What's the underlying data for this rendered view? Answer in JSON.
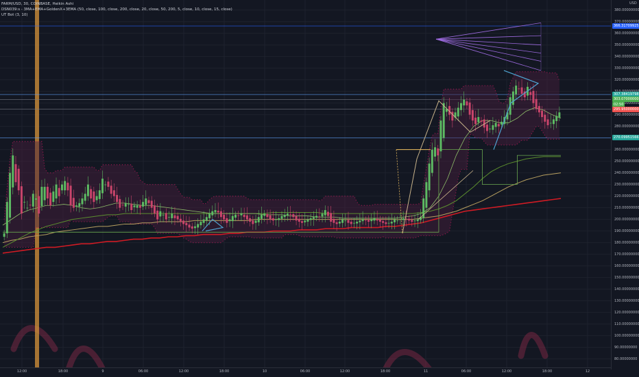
{
  "legend": {
    "line1": "FARM/USD, 30, COINBASE, Heikin Ashi",
    "line2": "DSN039:s - 3MA+EMA+GoldenX+3EMA (50, close, 100, close, 200, close, 20, close, 50, 200, 5, close, 10, close, 15, close)",
    "line3": "UT Bot (3, 10)"
  },
  "axis": {
    "currency": "USD",
    "price_ticks": [
      "380.00000000",
      "370.00000000",
      "360.00000000",
      "350.00000000",
      "340.00000000",
      "330.00000000",
      "320.00000000",
      "310.00000000",
      "300.00000000",
      "290.00000000",
      "280.00000000",
      "270.00000000",
      "260.00000000",
      "250.00000000",
      "240.00000000",
      "230.00000000",
      "220.00000000",
      "210.00000000",
      "200.00000000",
      "190.00000000",
      "180.00000000",
      "170.00000000",
      "160.00000000",
      "150.00000000",
      "140.00000000",
      "130.00000000",
      "120.00000000",
      "110.00000000",
      "100.00000000",
      "90.00000000",
      "80.00000000"
    ],
    "time_ticks": [
      "12:00",
      "18:00",
      "9",
      "06:00",
      "12:00",
      "18:00",
      "10",
      "06:00",
      "12:00",
      "18:00",
      "11",
      "06:00",
      "12:00",
      "18:00",
      "12"
    ]
  },
  "badges": [
    {
      "text": "366.31709925",
      "color": "#2962ff",
      "price": 366.3
    },
    {
      "text": "307.38419798",
      "color": "#26a69a",
      "price": 307.4
    },
    {
      "text": "303.07000000",
      "color": "#4caf50",
      "price": 303.1
    },
    {
      "text": "02:50",
      "color": "#4caf50",
      "price": 298.9
    },
    {
      "text": "295.95000000",
      "color": "#ef5350",
      "price": 294.8
    },
    {
      "text": "270.09951566",
      "color": "#26a69a",
      "price": 270.1
    }
  ],
  "chart_data": {
    "type": "candlestick",
    "symbol": "FARM/USD",
    "interval": "30",
    "exchange": "COINBASE",
    "style": "Heikin Ashi",
    "ylim": [
      75,
      385
    ],
    "x_labels": [
      "12:00",
      "18:00",
      "9",
      "06:00",
      "12:00",
      "18:00",
      "10",
      "06:00",
      "12:00",
      "18:00",
      "11",
      "06:00",
      "12:00",
      "18:00",
      "12"
    ],
    "close_series": [
      188,
      215,
      240,
      255,
      232,
      225,
      205,
      215,
      210,
      212,
      222,
      218,
      205,
      228,
      228,
      218,
      212,
      224,
      230,
      220,
      230,
      233,
      225,
      212,
      210,
      212,
      214,
      218,
      222,
      230,
      218,
      215,
      220,
      225,
      235,
      230,
      228,
      222,
      220,
      215,
      210,
      212,
      214,
      213,
      208,
      212,
      212,
      210,
      215,
      218,
      214,
      210,
      205,
      200,
      207,
      204,
      200,
      202,
      205,
      201,
      200,
      198,
      196,
      195,
      193,
      192,
      194,
      196,
      198,
      200,
      202,
      205,
      207,
      208,
      206,
      202,
      200,
      197,
      200,
      203,
      204,
      203,
      205,
      202,
      200,
      198,
      196,
      199,
      202,
      204,
      205,
      202,
      200,
      199,
      200,
      201,
      203,
      204,
      205,
      204,
      202,
      199,
      198,
      197,
      199,
      200,
      201,
      202,
      203,
      202,
      205,
      208,
      203,
      198,
      197,
      196,
      198,
      200,
      199,
      197,
      196,
      197,
      198,
      199,
      200,
      199,
      198,
      200,
      201,
      199,
      198,
      197,
      196,
      197,
      198,
      200,
      199,
      200,
      201,
      200,
      199,
      198,
      199,
      200,
      202,
      218,
      232,
      248,
      260,
      262,
      255,
      285,
      300,
      295,
      290,
      285,
      292,
      296,
      300,
      303,
      298,
      290,
      285,
      282,
      288,
      284,
      279,
      276,
      278,
      281,
      283,
      280,
      284,
      288,
      292,
      305,
      310,
      315,
      312,
      308,
      305,
      314,
      307,
      300,
      295,
      292,
      288,
      284,
      281,
      283,
      286,
      289,
      292
    ],
    "indicators": {
      "ma_fast_green": [
        195,
        200,
        205,
        208,
        210,
        212,
        212,
        213,
        212,
        210,
        209,
        210,
        212,
        214,
        214,
        213,
        212,
        212,
        211,
        210,
        209,
        208,
        207,
        206,
        205,
        205,
        205,
        205,
        205,
        205,
        204,
        204,
        204,
        203,
        203,
        203,
        202,
        202,
        202,
        201,
        201,
        201,
        201,
        201,
        201,
        201,
        202,
        203,
        205,
        210,
        220,
        235,
        255,
        270,
        280,
        285,
        285,
        283,
        283,
        287,
        293,
        296,
        294,
        290,
        287
      ],
      "ma_mid_olive": [
        176,
        180,
        184,
        188,
        191,
        194,
        196,
        198,
        200,
        201,
        202,
        203,
        204,
        204,
        205,
        205,
        205,
        205,
        205,
        205,
        205,
        205,
        205,
        205,
        205,
        205,
        205,
        205,
        205,
        205,
        205,
        206,
        206,
        206,
        206,
        206,
        206,
        205,
        205,
        205,
        205,
        205,
        205,
        205,
        205,
        205,
        205,
        205,
        206,
        207,
        209,
        212,
        216,
        222,
        228,
        235,
        241,
        245,
        248,
        250,
        252,
        253,
        254,
        254,
        254
      ],
      "ma_slow_khaki": [
        180,
        182,
        183,
        185,
        186,
        187,
        189,
        190,
        191,
        192,
        193,
        194,
        194,
        195,
        196,
        196,
        197,
        197,
        198,
        198,
        198,
        198,
        199,
        199,
        199,
        199,
        199,
        199,
        199,
        200,
        200,
        200,
        200,
        200,
        200,
        200,
        200,
        200,
        200,
        200,
        200,
        200,
        200,
        200,
        200,
        200,
        200,
        200,
        201,
        202,
        203,
        205,
        207,
        210,
        213,
        216,
        220,
        224,
        228,
        231,
        234,
        236,
        238,
        239,
        240
      ],
      "ema200_red": [
        171,
        172,
        173,
        174,
        175,
        176,
        176,
        177,
        178,
        179,
        179,
        180,
        181,
        181,
        182,
        183,
        183,
        184,
        184,
        185,
        185,
        186,
        186,
        187,
        187,
        187,
        188,
        188,
        189,
        189,
        189,
        190,
        190,
        190,
        191,
        191,
        191,
        192,
        192,
        192,
        193,
        193,
        193,
        193,
        194,
        194,
        195,
        196,
        197,
        199,
        201,
        203,
        205,
        207,
        208,
        209,
        210,
        211,
        212,
        213,
        214,
        215,
        216,
        217,
        218
      ],
      "ut_bot_stop": [
        189,
        189,
        189,
        189,
        189,
        189,
        189,
        189,
        189,
        189,
        189,
        189,
        189,
        189,
        189,
        189,
        189,
        189,
        189,
        189,
        189,
        189,
        189,
        189,
        189,
        189,
        189,
        189,
        189,
        189,
        189,
        189,
        189,
        189,
        189,
        189,
        189,
        189,
        189,
        189,
        189,
        189,
        189,
        189,
        189,
        189,
        189,
        189,
        189,
        189,
        260,
        260,
        260,
        260,
        260,
        230,
        230,
        230,
        230,
        255,
        255,
        255,
        255,
        255,
        255
      ]
    },
    "horizontal_levels": [
      366.3,
      307.4,
      303.1,
      294.8,
      270.1
    ]
  }
}
